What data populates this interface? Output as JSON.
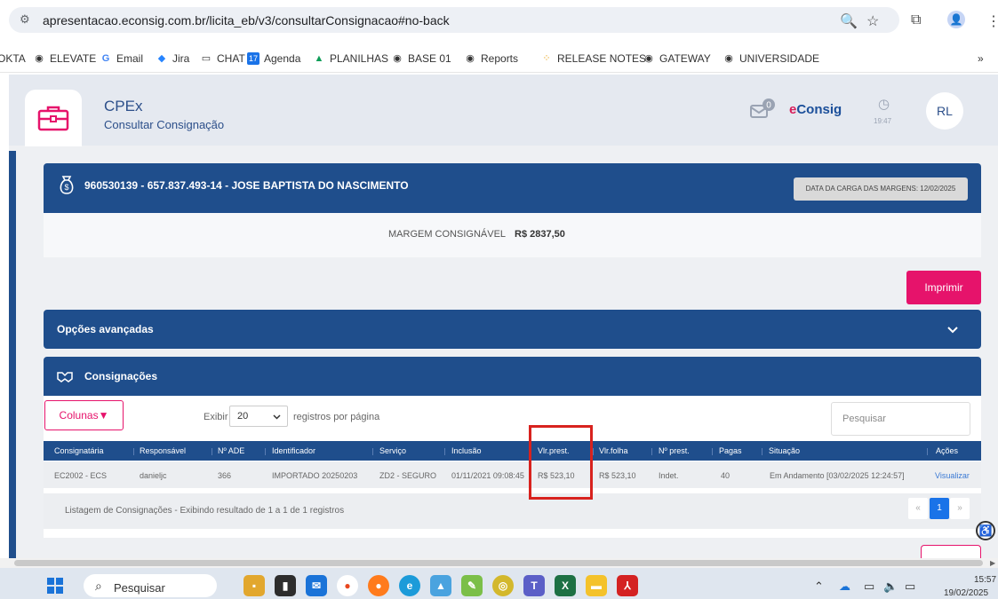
{
  "browser": {
    "url": "apresentacao.econsig.com.br/licita_eb/v3/consultarConsignacao#no-back",
    "bookmarks": [
      "OKTA",
      "ELEVATE",
      "Email",
      "Jira",
      "CHAT",
      "Agenda",
      "PLANILHAS",
      "BASE 01",
      "Reports",
      "RELEASE NOTES",
      "GATEWAY",
      "UNIVERSIDADE"
    ],
    "more": "»",
    "profile": "👤"
  },
  "header": {
    "system": "CPEx",
    "page_title": "Consultar Consignação",
    "brand_e": "e",
    "brand_rest": "Consig",
    "notification_count": "0",
    "clock_time": "19:47",
    "user_initials": "RL"
  },
  "client": {
    "title": "960530139 - 657.837.493-14 - JOSE BAPTISTA DO NASCIMENTO",
    "carga": "DATA DA CARGA DAS MARGENS: 12/02/2025",
    "margem_label": "MARGEM CONSIGNÁVEL",
    "margem_value": "R$ 2837,50"
  },
  "actions": {
    "imprimir": "Imprimir"
  },
  "opcoes": {
    "label": "Opções avançadas"
  },
  "consignacoes": {
    "title": "Consignações",
    "colunas": "Colunas▼",
    "exibir": "Exibir",
    "page_size": "20",
    "registros": "registros por página",
    "search_placeholder": "Pesquisar",
    "columns": [
      "Consignatária",
      "Responsável",
      "Nº ADE",
      "Identificador",
      "Serviço",
      "Inclusão",
      "Vlr.prest.",
      "Vlr.folha",
      "Nº prest.",
      "Pagas",
      "Situação",
      "Ações"
    ],
    "row": [
      "EC2002 - ECS",
      "danieljc",
      "366",
      "IMPORTADO 20250203",
      "ZD2 - SEGURO",
      "01/11/2021 09:08:45",
      "R$ 523,10",
      "R$ 523,10",
      "Indet.",
      "40",
      "Em Andamento [03/02/2025 12:24:57]",
      "Visualizar"
    ],
    "footer": "Listagem de Consignações - Exibindo resultado de 1 a 1 de 1 registros",
    "pagination": {
      "prev": "«",
      "current": "1",
      "next": "»"
    }
  },
  "taskbar": {
    "search": "Pesquisar",
    "time": "15:57",
    "date": "19/02/2025"
  },
  "colors": {
    "primary": "#1f4e8c",
    "accent": "#e6136b",
    "highlight": "#d8221e"
  }
}
